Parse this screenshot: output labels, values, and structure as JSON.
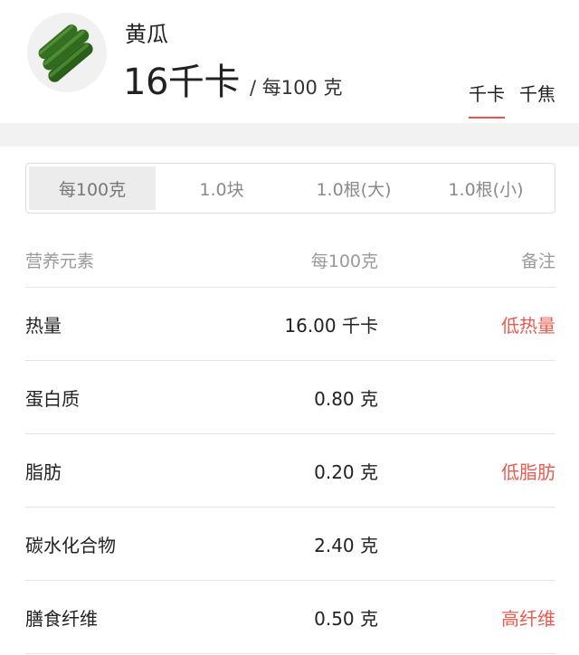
{
  "food": {
    "name": "黄瓜",
    "calories": "16千卡",
    "per_unit": "/ 每100 克"
  },
  "unit_tabs": [
    {
      "label": "千卡",
      "active": true
    },
    {
      "label": "千焦",
      "active": false
    }
  ],
  "portions": [
    {
      "label": "每100克",
      "active": true
    },
    {
      "label": "1.0块",
      "active": false
    },
    {
      "label": "1.0根(大)",
      "active": false
    },
    {
      "label": "1.0根(小)",
      "active": false
    }
  ],
  "table": {
    "headers": {
      "name": "营养元素",
      "value": "每100克",
      "note": "备注"
    },
    "rows": [
      {
        "name": "热量",
        "value": "16.00 千卡",
        "note": "低热量"
      },
      {
        "name": "蛋白质",
        "value": "0.80 克",
        "note": ""
      },
      {
        "name": "脂肪",
        "value": "0.20 克",
        "note": "低脂肪"
      },
      {
        "name": "碳水化合物",
        "value": "2.40 克",
        "note": ""
      },
      {
        "name": "膳食纤维",
        "value": "0.50 克",
        "note": "高纤维"
      }
    ]
  },
  "colors": {
    "accent": "#e8554e",
    "note": "#ea5a4f",
    "band": "#f2f2f2"
  }
}
